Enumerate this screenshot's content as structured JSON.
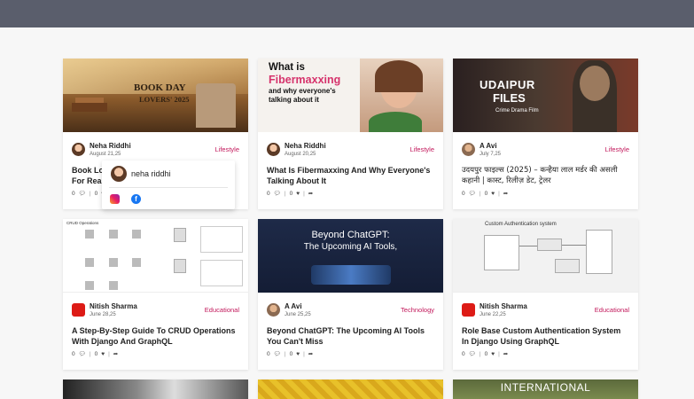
{
  "cards": [
    {
      "thumb_lines": [
        "BOOK DAY",
        "LOVERS' 2025"
      ],
      "author": "Neha Riddhi",
      "date": "August 21,25",
      "category": "Lifestyle",
      "title": "Book Lo\nFor Rea",
      "comments": "0",
      "likes": "0"
    },
    {
      "thumb_lines": [
        "What is",
        "Fibermaxxing",
        "and why everyone's",
        "talking about it"
      ],
      "author": "Neha Riddhi",
      "date": "August 20,25",
      "category": "Lifestyle",
      "title": "What Is Fibermaxxing And Why Everyone's Talking About It",
      "comments": "0",
      "likes": "0"
    },
    {
      "thumb_lines": [
        "UDAIPUR",
        "FILES",
        "Crime Drama Film"
      ],
      "author": "A Avi",
      "date": "July 7,25",
      "category": "Lifestyle",
      "title": "उदयपुर फाइल्स (2025) – कन्हैया लाल मर्डर की असली कहानी | कास्ट, रिलीज़ डेट, ट्रेलर",
      "comments": "0",
      "likes": "0"
    },
    {
      "thumb_lines": [
        "CRUD Operations"
      ],
      "author": "Nitish Sharma",
      "date": "June 28,25",
      "category": "Educational",
      "title": "A Step-By-Step Guide To CRUD Operations With Django And GraphQL",
      "comments": "0",
      "likes": "0"
    },
    {
      "thumb_lines": [
        "Beyond ChatGPT:",
        "The Upcoming AI Tools,"
      ],
      "author": "A Avi",
      "date": "June 25,25",
      "category": "Technology",
      "title": "Beyond ChatGPT: The Upcoming AI Tools You Can't Miss",
      "comments": "0",
      "likes": "0"
    },
    {
      "thumb_lines": [
        "Custom Authentication system"
      ],
      "author": "Nitish Sharma",
      "date": "June 22,25",
      "category": "Educational",
      "title": "Role Base Custom Authentication System In Django Using GraphQL",
      "comments": "0",
      "likes": "0"
    }
  ],
  "bottom_row": [
    {
      "thumb_text": ""
    },
    {
      "thumb_text": ""
    },
    {
      "thumb_text": "INTERNATIONAL"
    }
  ],
  "popup": {
    "name": "neha riddhi"
  },
  "icons": {
    "comment": "comment-icon",
    "like": "heart-icon",
    "share": "share-icon",
    "instagram": "instagram-icon",
    "facebook": "facebook-icon"
  },
  "colors": {
    "topbar": "#5a5e6c",
    "category": "#c2185b",
    "background": "#f7f7f7"
  }
}
